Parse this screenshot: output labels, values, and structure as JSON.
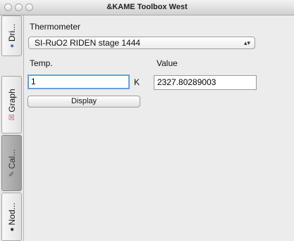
{
  "window": {
    "title": "&KAME Toolbox West"
  },
  "sidebar": {
    "tabs": [
      {
        "label": "Dri...",
        "icon": "driver-icon",
        "selected": false
      },
      {
        "label": "Graph",
        "icon": "graph-icon",
        "selected": false
      },
      {
        "label": "Cal...",
        "icon": "calibration-icon",
        "selected": true
      },
      {
        "label": "Nod...",
        "icon": "node-icon",
        "selected": false
      }
    ]
  },
  "form": {
    "thermometer_label": "Thermometer",
    "thermometer_value": "SI-RuO2 RIDEN stage 1444",
    "temp_label": "Temp.",
    "temp_value": "1",
    "temp_unit": "K",
    "value_label": "Value",
    "value_value": "2327.80289003",
    "display_button": "Display"
  }
}
